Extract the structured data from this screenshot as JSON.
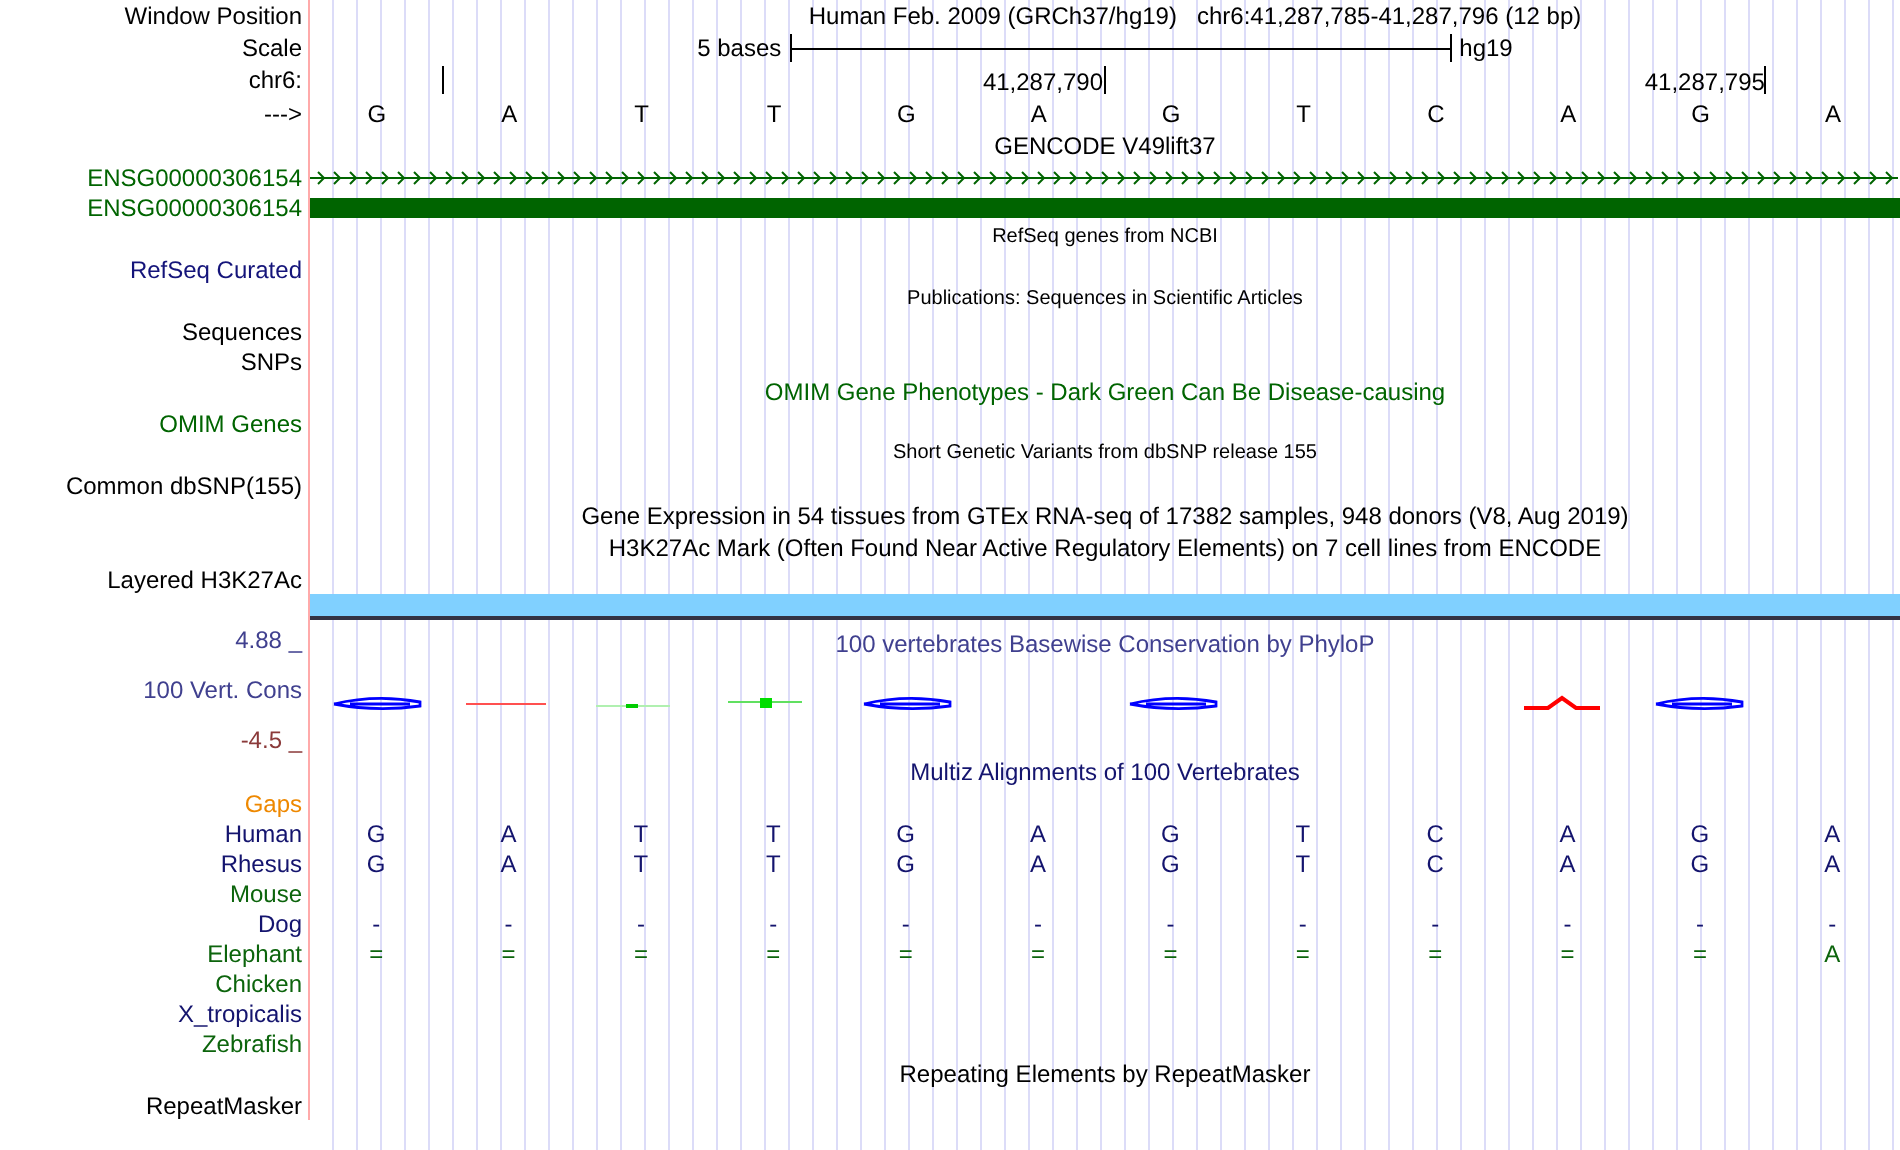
{
  "position": {
    "label": "Window Position",
    "assembly": "Human Feb. 2009 (GRCh37/hg19)",
    "range": "chr6:41,287,785-41,287,796 (12 bp)"
  },
  "scale": {
    "label": "Scale",
    "length": "5 bases",
    "assembly": "hg19"
  },
  "coordinates": {
    "label": "chr6:",
    "ticks": [
      "41,287,790",
      "41,287,795"
    ]
  },
  "sequence": {
    "label": "--->",
    "bases": [
      "G",
      "A",
      "T",
      "T",
      "G",
      "A",
      "G",
      "T",
      "C",
      "A",
      "G",
      "A"
    ]
  },
  "tracks": [
    {
      "kind": "title",
      "text": "GENCODE V49lift37"
    },
    {
      "kind": "gene-arrows",
      "label": "ENSG00000306154",
      "color": "#006400"
    },
    {
      "kind": "gene-block",
      "label": "ENSG00000306154",
      "color": "#006400"
    },
    {
      "kind": "note",
      "text": "RefSeq genes from NCBI"
    },
    {
      "kind": "label",
      "label": "RefSeq Curated",
      "color": "#14147a"
    },
    {
      "kind": "note",
      "text": "Publications: Sequences in Scientific Articles"
    },
    {
      "kind": "label",
      "label": "Sequences"
    },
    {
      "kind": "label",
      "label": "SNPs"
    },
    {
      "kind": "title",
      "text": "OMIM Gene Phenotypes - Dark Green Can Be Disease-causing",
      "color": "#006400"
    },
    {
      "kind": "label",
      "label": "OMIM Genes",
      "color": "#006400"
    },
    {
      "kind": "note",
      "text": "Short Genetic Variants from dbSNP release 155"
    },
    {
      "kind": "label",
      "label": "Common dbSNP(155)"
    },
    {
      "kind": "title",
      "text": "Gene Expression in 54 tissues from GTEx RNA-seq of 17382 samples, 948 donors (V8, Aug 2019)"
    },
    {
      "kind": "title",
      "text": "H3K27Ac Mark (Often Found Near Active Regulatory Elements) on 7 cell lines from ENCODE"
    },
    {
      "kind": "label",
      "label": "Layered H3K27Ac"
    },
    {
      "kind": "band"
    },
    {
      "kind": "wiggle",
      "label": "100 Vert. Cons",
      "max": "4.88 _",
      "min": "-4.5 _",
      "text": "100 vertebrates Basewise Conservation by PhyloP",
      "color": "#40408f"
    },
    {
      "kind": "title",
      "text": "Multiz Alignments of 100 Vertebrates",
      "color": "#14146e"
    },
    {
      "kind": "label",
      "label": "Gaps",
      "color": "#ee8800"
    },
    {
      "kind": "species",
      "label": "Human",
      "color": "#14146e",
      "bases": [
        "G",
        "A",
        "T",
        "T",
        "G",
        "A",
        "G",
        "T",
        "C",
        "A",
        "G",
        "A"
      ]
    },
    {
      "kind": "species",
      "label": "Rhesus",
      "color": "#14146e",
      "bases": [
        "G",
        "A",
        "T",
        "T",
        "G",
        "A",
        "G",
        "T",
        "C",
        "A",
        "G",
        "A"
      ]
    },
    {
      "kind": "label",
      "label": "Mouse",
      "color": "#0c640c"
    },
    {
      "kind": "species",
      "label": "Dog",
      "color": "#14146e",
      "bases": [
        "-",
        "-",
        "-",
        "-",
        "-",
        "-",
        "-",
        "-",
        "-",
        "-",
        "-",
        "-"
      ]
    },
    {
      "kind": "species",
      "label": "Elephant",
      "color": "#0c640c",
      "bases": [
        "=",
        "=",
        "=",
        "=",
        "=",
        "=",
        "=",
        "=",
        "=",
        "=",
        "=",
        "A"
      ]
    },
    {
      "kind": "label",
      "label": "Chicken",
      "color": "#0c640c"
    },
    {
      "kind": "label",
      "label": "X_tropicalis",
      "color": "#14146e"
    },
    {
      "kind": "label",
      "label": "Zebrafish",
      "color": "#0c640c"
    },
    {
      "kind": "title",
      "text": "Repeating Elements by RepeatMasker"
    },
    {
      "kind": "label",
      "label": "RepeatMasker"
    }
  ]
}
